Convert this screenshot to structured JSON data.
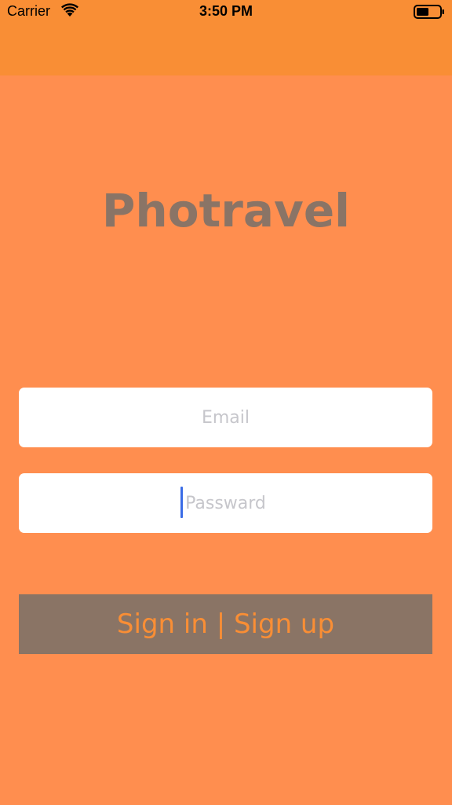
{
  "status_bar": {
    "carrier": "Carrier",
    "time": "3:50 PM",
    "wifi_icon": "wifi-icon",
    "battery_icon": "battery-icon"
  },
  "app": {
    "title": "Photravel"
  },
  "form": {
    "email": {
      "placeholder": "Email",
      "value": ""
    },
    "password": {
      "placeholder": "Passward",
      "value": ""
    },
    "submit_label": "Sign in | Sign up"
  },
  "colors": {
    "background": "#FF8E4F",
    "top_bar": "#F98E35",
    "title": "#8A7466",
    "button_bg": "#8A7465",
    "button_text": "#F98E35",
    "placeholder": "#C6C6CB",
    "caret": "#3A6CE6"
  }
}
